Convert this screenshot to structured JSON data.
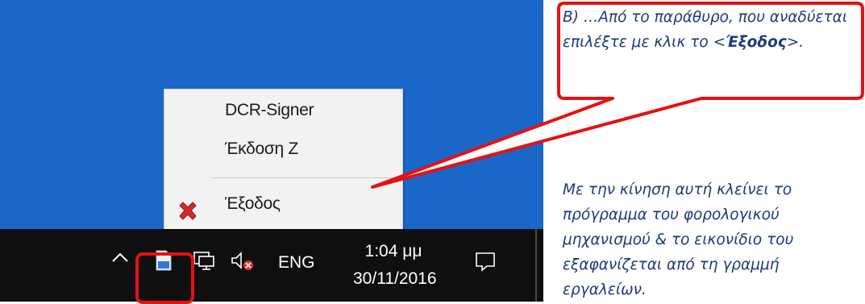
{
  "menu": {
    "items": [
      {
        "label": "DCR-Signer"
      },
      {
        "label": "Έκδοση Ζ"
      },
      {
        "label": "Έξοδος"
      }
    ]
  },
  "taskbar": {
    "language": "ENG",
    "time": "1:04 μμ",
    "date": "30/11/2016"
  },
  "annotations": {
    "callout_prefix": "Β) …Από το παράθυρο, που αναδύεται επιλέξτε με κλικ το <",
    "callout_bold": "Έξοδος",
    "callout_suffix": ">.",
    "side_note": "Με την κίνηση αυτή κλείνει το πρόγραμμα του φορολογικού μηχανισμού & το εικονίδιο του εξαφανίζεται από τη γραμμή εργαλείων."
  },
  "colors": {
    "desktop": "#1a66c9",
    "taskbar": "#0f0f10",
    "annotation_red": "#e41212",
    "annotation_text": "#1f3a7a"
  },
  "icons": {
    "exit": "red-x-icon",
    "app_tray": "document-app-icon",
    "network": "network-icon",
    "volume": "volume-muted-icon",
    "notifications": "notification-icon",
    "overflow": "chevron-up-icon"
  }
}
